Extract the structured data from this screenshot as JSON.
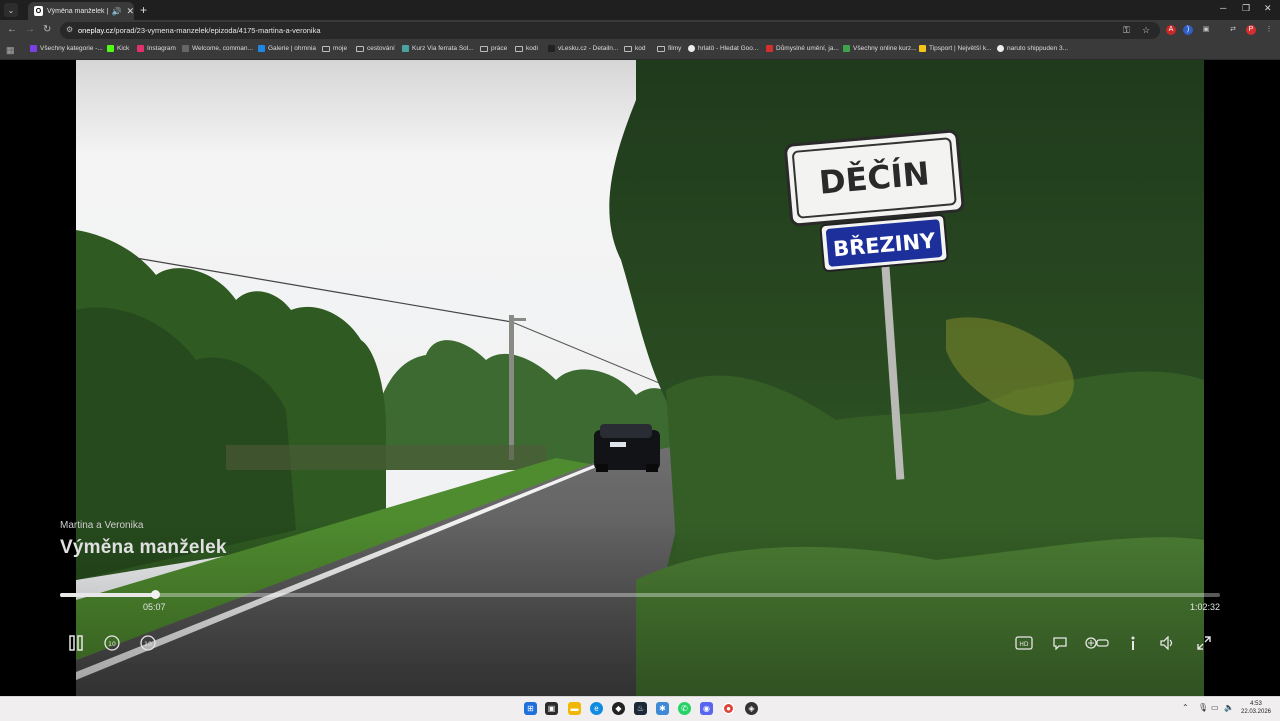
{
  "browser": {
    "tab_title": "Výměna manželek | Oneplay",
    "favicon_letter": "O",
    "new_tab_label": "+",
    "url_host": "oneplay.cz",
    "url_path": "/porad/23-vymena-manzelek/epizoda/4175-martina-a-veronika"
  },
  "bookmarks": [
    {
      "label": "Všechny kategorie -...",
      "icon": "purple",
      "kind": "site"
    },
    {
      "label": "Kick",
      "icon": "green",
      "kind": "site"
    },
    {
      "label": "Instagram",
      "icon": "pink",
      "kind": "site"
    },
    {
      "label": "Welcome, comman...",
      "icon": "gray",
      "kind": "site"
    },
    {
      "label": "Galerie | ohrnnia",
      "icon": "blue",
      "kind": "site"
    },
    {
      "label": "moje",
      "icon": "folder",
      "kind": "folder"
    },
    {
      "label": "cestování",
      "icon": "folder",
      "kind": "folder"
    },
    {
      "label": "Kurz Via ferrata Sol...",
      "icon": "teal",
      "kind": "site"
    },
    {
      "label": "práce",
      "icon": "folder",
      "kind": "folder"
    },
    {
      "label": "kodi",
      "icon": "folder",
      "kind": "folder"
    },
    {
      "label": "vLesku.cz - Detailn...",
      "icon": "dark",
      "kind": "site"
    },
    {
      "label": "kod",
      "icon": "folder",
      "kind": "folder"
    },
    {
      "label": "filmy",
      "icon": "folder",
      "kind": "folder"
    },
    {
      "label": "hrlatö - Hledat Goo...",
      "icon": "google",
      "kind": "site"
    },
    {
      "label": "Důmyslné umění, ja...",
      "icon": "red",
      "kind": "site"
    },
    {
      "label": "Všechny online kurz...",
      "icon": "multi",
      "kind": "site"
    },
    {
      "label": "Tipsport | Největší k...",
      "icon": "yellow",
      "kind": "site"
    },
    {
      "label": "naruto shippuden 3...",
      "icon": "google",
      "kind": "site"
    }
  ],
  "video": {
    "sign_city": "DĚČÍN",
    "sign_part": "BŘEZINY"
  },
  "player": {
    "episode_subtitle": "Martina a Veronika",
    "show_title": "Výměna manželek",
    "current_time": "05:07",
    "total_time": "1:02:32",
    "progress_fraction": 0.082
  },
  "taskbar": {
    "time": "4:53",
    "date": "22.03.2026"
  },
  "colors": {
    "browser_frame": "#3a3a3a",
    "tab_strip": "#1f1f1f",
    "sign_blue": "#1c2f9a",
    "taskbar": "#f0eeee"
  }
}
